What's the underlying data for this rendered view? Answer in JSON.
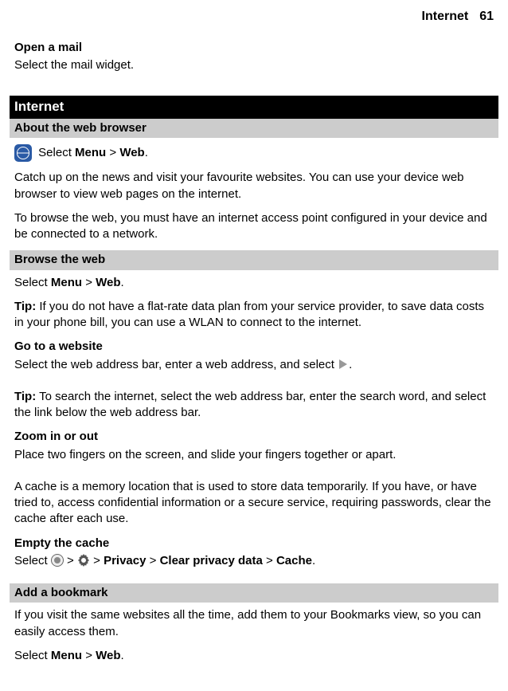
{
  "header": {
    "chapter": "Internet",
    "page_number": "61"
  },
  "open_mail": {
    "title": "Open a mail",
    "body": "Select the mail widget."
  },
  "black_bar": "Internet",
  "about": {
    "bar": "About the web browser",
    "select_prefix": "Select ",
    "menu": "Menu",
    "gt": " > ",
    "web": "Web",
    "period": ".",
    "para1": "Catch up on the news and visit your favourite websites. You can use your device web browser to view web pages on the internet.",
    "para2": "To browse the web, you must have an internet access point configured in your device and be connected to a network."
  },
  "browse": {
    "bar": "Browse the web",
    "select_prefix": "Select ",
    "menu": "Menu",
    "gt": " > ",
    "web": "Web",
    "period": ".",
    "tip_label": "Tip:",
    "tip_body": " If you do not have a flat-rate data plan from your service provider, to save data costs in your phone bill, you can use a WLAN to connect to the internet."
  },
  "goto": {
    "title": "Go to a website",
    "body_pre": "Select the web address bar, enter a web address, and select ",
    "body_post": "."
  },
  "tip2": {
    "label": "Tip:",
    "body": " To search the internet, select the web address bar, enter the search word, and select the link below the web address bar."
  },
  "zoom": {
    "title": "Zoom in or out",
    "body": "Place two fingers on the screen, and slide your fingers together or apart."
  },
  "cache_para": "A cache is a memory location that is used to store data temporarily. If you have, or have tried to, access confidential information or a secure service, requiring passwords, clear the cache after each use.",
  "empty_cache": {
    "title": "Empty the cache",
    "select_prefix": "Select ",
    "gt": " > ",
    "privacy": "Privacy",
    "clear": "Clear privacy data",
    "cache": "Cache",
    "period": "."
  },
  "bookmark": {
    "bar": "Add a bookmark",
    "para": "If you visit the same websites all the time, add them to your Bookmarks view, so you can easily access them.",
    "select_prefix": "Select ",
    "menu": "Menu",
    "gt": " > ",
    "web": "Web",
    "period": "."
  }
}
